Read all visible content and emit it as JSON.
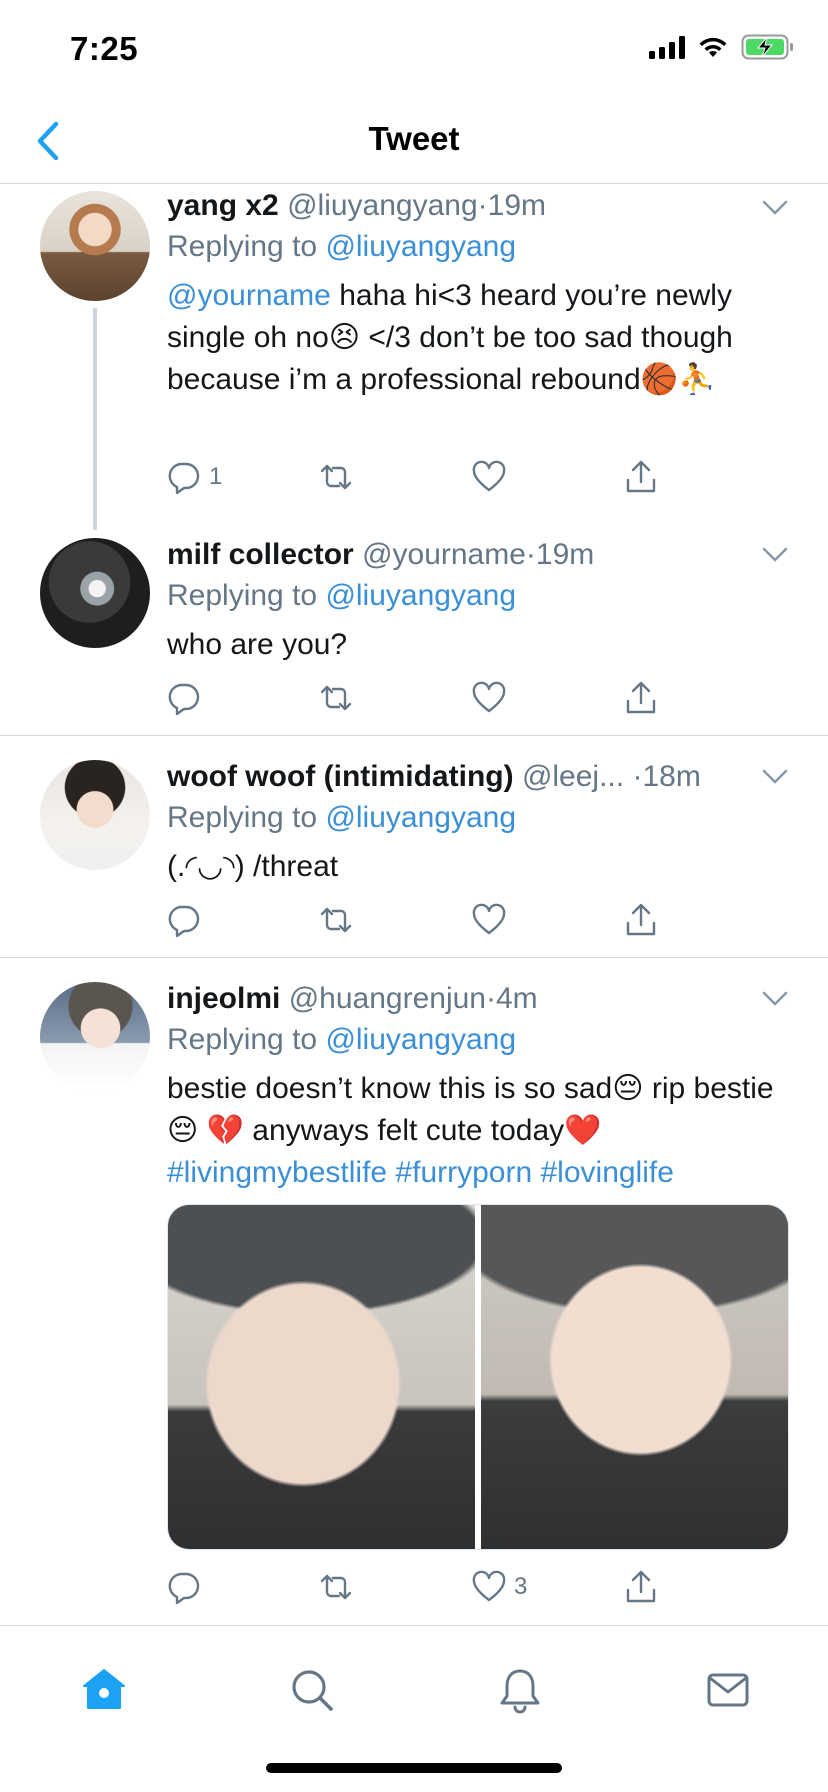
{
  "status_bar": {
    "time": "7:25"
  },
  "header": {
    "title": "Tweet"
  },
  "tweets": [
    {
      "name": "yang x2",
      "handle": "@liuyangyang",
      "dot": "·",
      "time": "19m",
      "replying_prefix": "Replying to ",
      "replying_to": "@liuyangyang",
      "mention": "@yourname",
      "text": " haha hi<3 heard you’re newly single oh no😣 </3 don’t be too sad though because i’m a professional rebound🏀⛹️",
      "reply_count": "1",
      "retweet_count": "",
      "like_count": ""
    },
    {
      "name": "milf collector",
      "handle": "@yourname",
      "dot": "·",
      "time": "19m",
      "replying_prefix": "Replying to ",
      "replying_to": "@liuyangyang",
      "text": "who are you?",
      "reply_count": "",
      "like_count": ""
    },
    {
      "name": "woof woof (intimidating)",
      "handle": "@leej...",
      "dot": "·",
      "time": "18m",
      "replying_prefix": "Replying to ",
      "replying_to": "@liuyangyang",
      "text": "(.◜◡◝) /threat",
      "reply_count": "",
      "like_count": ""
    },
    {
      "name": "injeolmi",
      "handle": "@huangrenjun",
      "dot": "·",
      "time": "4m",
      "replying_prefix": "Replying to ",
      "replying_to": "@liuyangyang",
      "text": "bestie doesn’t know this is so sad😔 rip bestie😔 💔 anyways felt cute today❤️",
      "hashtags": "#livingmybestlife #furryporn #lovinglife",
      "reply_count": "",
      "like_count": "3"
    }
  ],
  "colors": {
    "accent": "#1da1f2",
    "muted": "#657786",
    "divider": "#cfd9de"
  },
  "tabbar": {
    "icons": [
      "home-icon",
      "search-icon",
      "notifications-icon",
      "messages-icon"
    ],
    "active": "home-icon"
  }
}
